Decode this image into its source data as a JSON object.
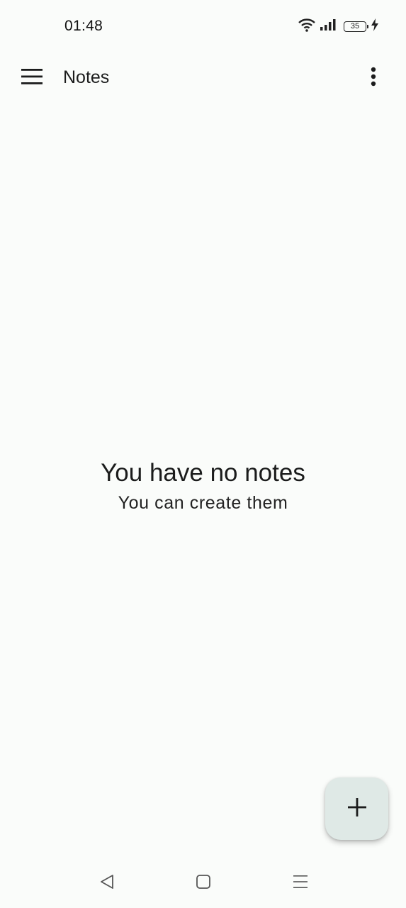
{
  "status_bar": {
    "time": "01:48",
    "battery_level": "35",
    "icons": [
      "wifi-icon",
      "signal-icon",
      "battery-icon",
      "charging-icon"
    ]
  },
  "app_bar": {
    "title": "Notes",
    "menu_icon": "hamburger-menu-icon",
    "overflow_icon": "more-vert-icon"
  },
  "empty_state": {
    "title": "You have no notes",
    "subtitle": "You can create them"
  },
  "fab": {
    "icon": "plus-icon",
    "color": "#dfe9e6"
  },
  "nav_bar": {
    "buttons": [
      "back-icon",
      "home-icon",
      "recents-icon"
    ]
  },
  "colors": {
    "background": "#fafcfa",
    "text": "#1b1c1c"
  }
}
